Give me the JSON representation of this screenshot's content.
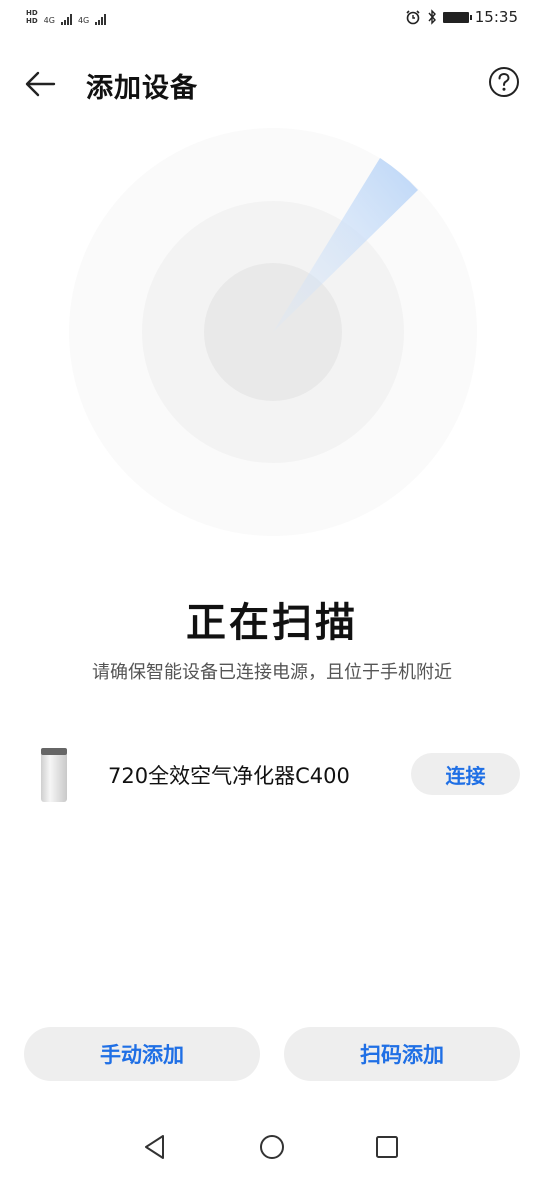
{
  "status_bar": {
    "hd_badges": [
      "HD",
      "HD"
    ],
    "network_labels": [
      "4G",
      "4G"
    ],
    "time": "15:35",
    "icons": [
      "alarm-icon",
      "bluetooth-icon",
      "battery-icon"
    ]
  },
  "header": {
    "title": "添加设备",
    "back_icon": "arrow-left-icon",
    "help_icon": "question-circle-icon"
  },
  "scan": {
    "title": "正在扫描",
    "subtitle": "请确保智能设备已连接电源，且位于手机附近"
  },
  "devices": [
    {
      "name": "720全效空气净化器C400",
      "action_label": "连接"
    }
  ],
  "actions": {
    "manual_add_label": "手动添加",
    "scan_code_add_label": "扫码添加"
  },
  "nav_bar": {
    "icons": [
      "nav-back-icon",
      "nav-home-icon",
      "nav-recent-icon"
    ]
  },
  "colors": {
    "accent": "#1f6fe5",
    "button_bg": "#eeeeee",
    "radar_ring_outer": "#fafafa",
    "radar_ring_mid": "#f3f3f3",
    "radar_ring_inner": "#e9e9e9"
  }
}
